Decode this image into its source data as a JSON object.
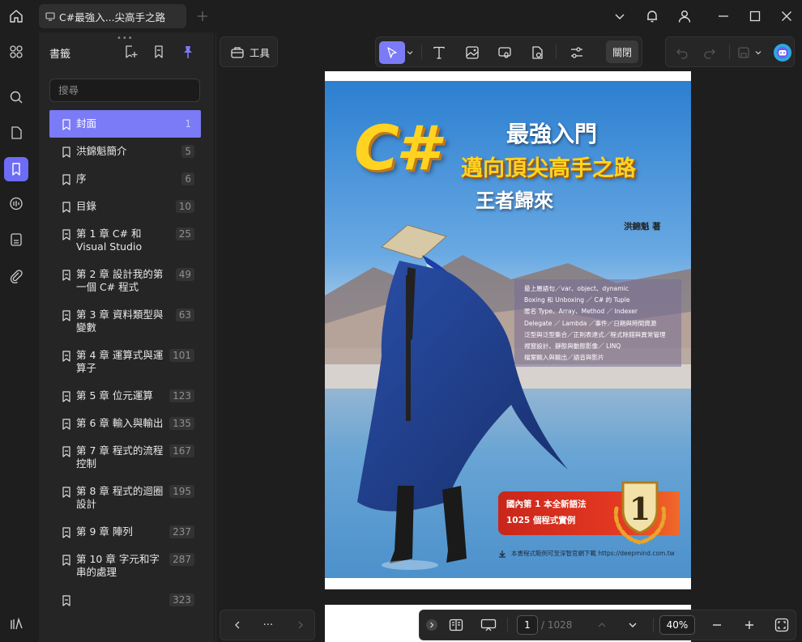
{
  "titlebar": {
    "tab_title": "C#最強入...尖高手之路"
  },
  "panel": {
    "title": "書籤",
    "search_placeholder": "搜尋",
    "bookmarks": [
      {
        "label": "封面",
        "page": "1",
        "active": true
      },
      {
        "label": "洪錦魁簡介",
        "page": "5"
      },
      {
        "label": "序",
        "page": "6"
      },
      {
        "label": "目錄",
        "page": "10"
      },
      {
        "label": "第 1 章 C# 和 Visual Studio",
        "page": "25"
      },
      {
        "label": "第 2 章 設計我的第一個 C# 程式",
        "page": "49"
      },
      {
        "label": "第 3 章 資料類型與變數",
        "page": "63"
      },
      {
        "label": "第 4 章 運算式與運算子",
        "page": "101"
      },
      {
        "label": "第 5 章 位元運算",
        "page": "123"
      },
      {
        "label": "第 6 章 輸入與輸出",
        "page": "135"
      },
      {
        "label": "第 7 章 程式的流程控制",
        "page": "167"
      },
      {
        "label": "第 8 章 程式的迴圈設計",
        "page": "195"
      },
      {
        "label": "第 9 章 陣列",
        "page": "237"
      },
      {
        "label": "第 10 章 字元和字串的處理",
        "page": "287"
      },
      {
        "label": "",
        "page": "323"
      }
    ]
  },
  "toolbar": {
    "tools_label": "工具",
    "close_label": "關閉"
  },
  "cover": {
    "title_cs": "C#",
    "title_line1": "最強入門",
    "title_line2": "邁向頂尖高手之路",
    "title_line3": "王者歸來",
    "author": "洪錦魁 著",
    "topics": [
      "最上層語句／var、object、dynamic",
      "Boxing 和 Unboxing ／ C# 的 Tuple",
      "匿名 Type、Array、Method ／ Indexer",
      "Delegate ／ Lambda ／事件／日期與時間資源",
      "泛型與泛型集合／正則表達式／程式除錯與異常管理",
      "視窗設計、靜態與動態影像／ LINQ",
      "檔案輸入與輸出／語音與影片"
    ],
    "badge_line1": "國內第 1 本全新語法",
    "badge_line2": "1025 個程式實例",
    "medal_number": "1",
    "download_note": "本書程式範例可至深智官網下載 https://deepmind.com.tw"
  },
  "bottombar": {
    "page_current": "1",
    "page_total": "/ 1028",
    "zoom": "40%",
    "more": "···"
  },
  "colors": {
    "accent": "#7b7bf7",
    "rail_active": "#6c6cf5"
  }
}
